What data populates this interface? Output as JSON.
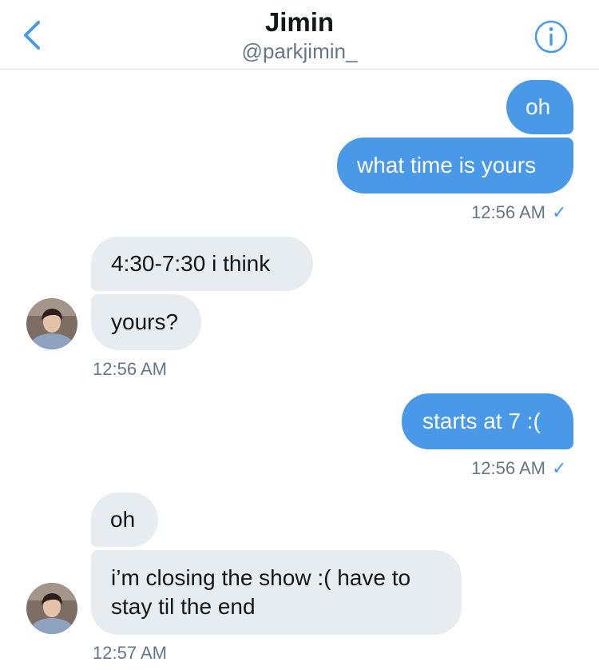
{
  "header": {
    "title": "Jimin",
    "handle": "@parkjimin_",
    "back_icon": "chevron-left-icon",
    "info_icon": "info-circle-icon"
  },
  "colors": {
    "accent": "#4a99e9",
    "incoming_bubble": "#e6ecf0",
    "meta_text": "#657786"
  },
  "conversation": {
    "group1": {
      "msg1": "oh",
      "msg2": "what time is yours",
      "time": "12:56 AM",
      "check": "✓"
    },
    "group2": {
      "msg1": "4:30-7:30 i think",
      "msg2": "yours?",
      "time": "12:56 AM"
    },
    "group3": {
      "msg1": "starts at 7 :(",
      "time": "12:56 AM",
      "check": "✓"
    },
    "group4": {
      "msg1": "oh",
      "msg2_line1": "i’m closing the show :( have to",
      "msg2_line2": "stay til the end",
      "time": "12:57 AM"
    }
  }
}
